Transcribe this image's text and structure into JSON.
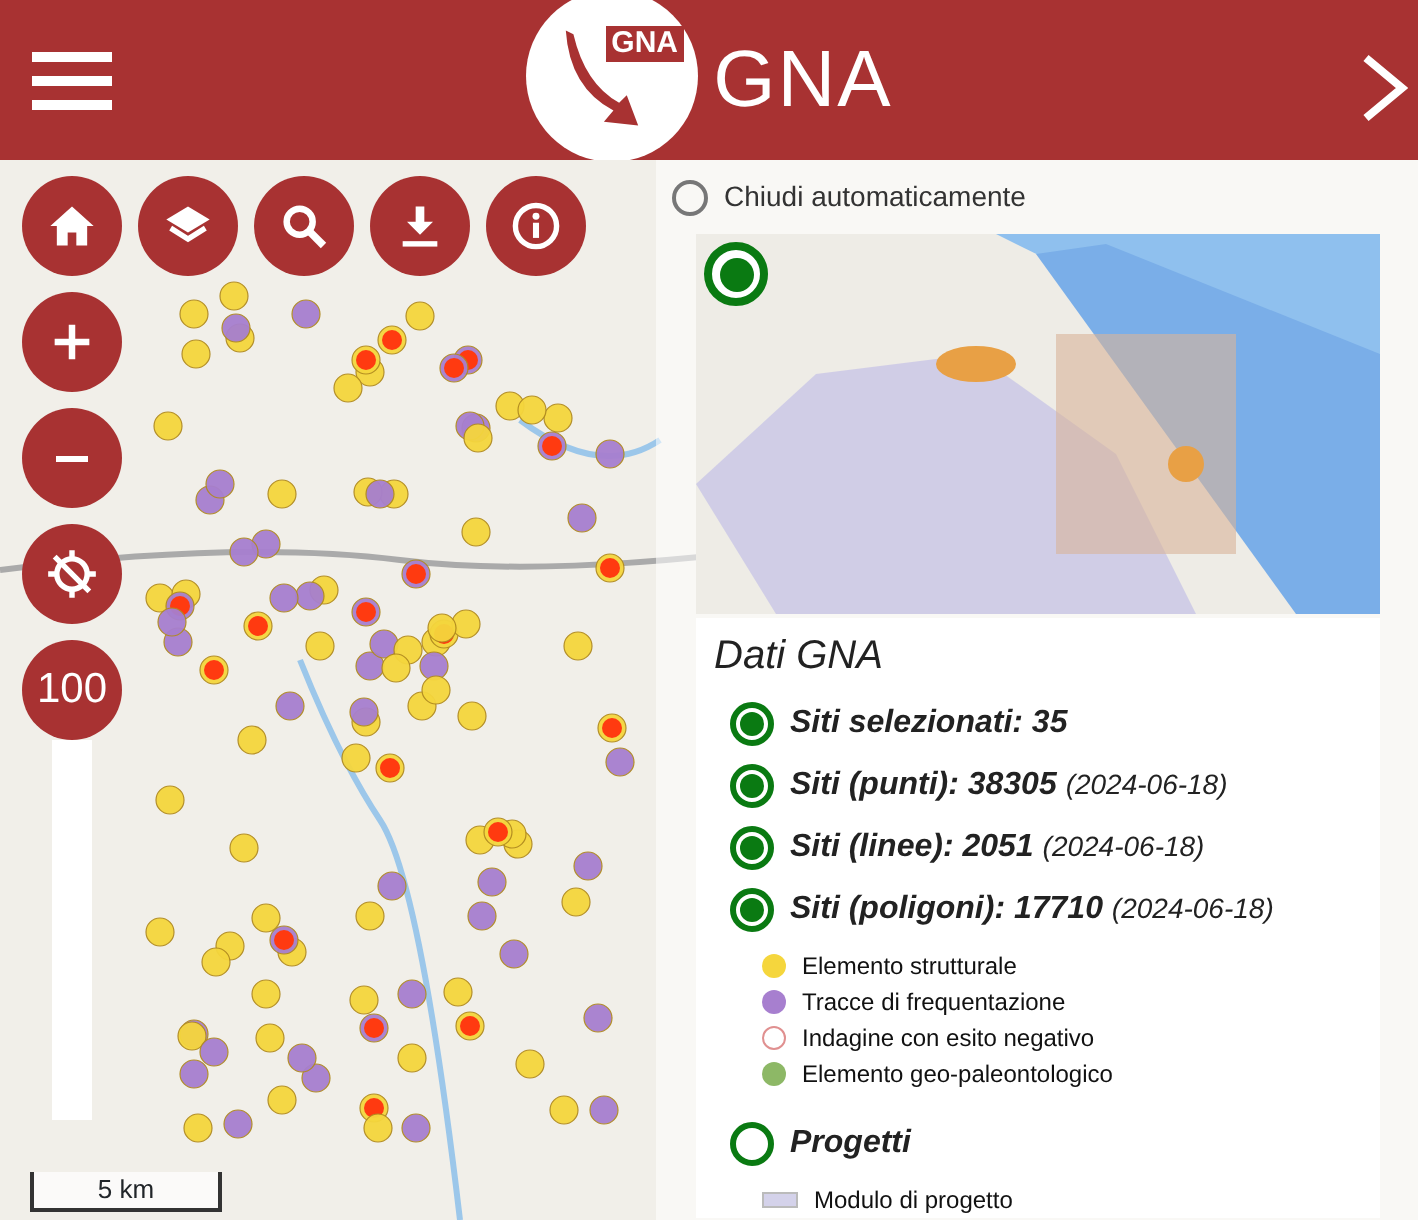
{
  "header": {
    "logo_text": "GNA",
    "title": "GNA"
  },
  "map_controls": {
    "zoom_label": "100"
  },
  "scale": {
    "label": "5 km"
  },
  "panel": {
    "auto_close": {
      "label": "Chiudi automaticamente",
      "checked": false
    },
    "preview": {
      "selected": true
    },
    "legend": {
      "title": "Dati GNA",
      "layers": [
        {
          "label": "Siti selezionati: 35",
          "checked": true
        },
        {
          "label": "Siti (punti): 38305",
          "date": "(2024-06-18)",
          "checked": true
        },
        {
          "label": "Siti (linee): 2051",
          "date": "(2024-06-18)",
          "checked": true
        },
        {
          "label": "Siti (poligoni): 17710",
          "date": "(2024-06-18)",
          "checked": true
        }
      ],
      "symbols": [
        {
          "label": "Elemento strutturale",
          "kind": "filled",
          "color": "#f5d63d"
        },
        {
          "label": "Tracce di frequentazione",
          "kind": "filled",
          "color": "#a77fcf"
        },
        {
          "label": "Indagine con esito negativo",
          "kind": "outline",
          "color": "#e09090"
        },
        {
          "label": "Elemento geo-paleontologico",
          "kind": "filled",
          "color": "#8db866"
        }
      ],
      "projects": {
        "label": "Progetti",
        "checked": false,
        "symbols": [
          {
            "label": "Modulo di progetto",
            "kind": "area",
            "color": "#d4d2ea"
          }
        ]
      }
    }
  }
}
